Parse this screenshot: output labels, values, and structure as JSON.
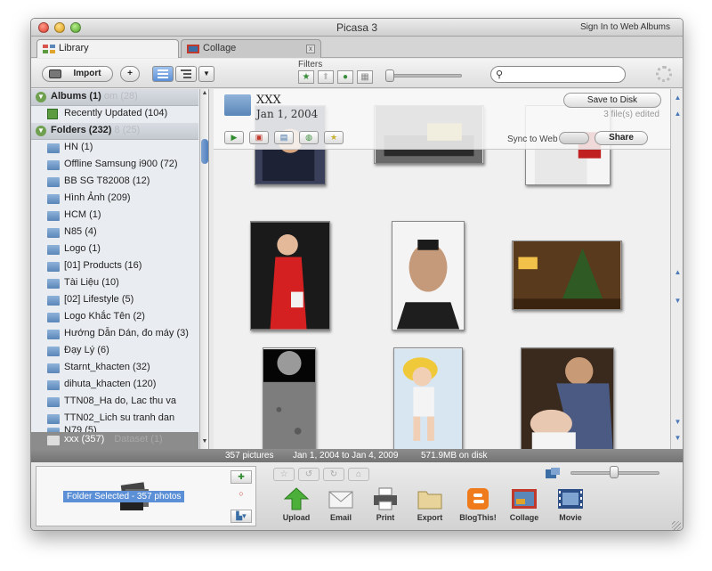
{
  "window": {
    "title": "Picasa 3",
    "sign_in": "Sign In to Web Albums"
  },
  "tabs": [
    {
      "label": "Library"
    },
    {
      "label": "Collage",
      "close": "x"
    }
  ],
  "toolbar": {
    "import_label": "Import",
    "add_folder_label": "+",
    "filters_label": "Filters",
    "search_placeholder": ""
  },
  "sidebar": {
    "albums_header": "Albums (1)",
    "albums_ghost": "om (28)",
    "recently_updated": "Recently Updated (104)",
    "folders_header": "Folders (232)",
    "folders_ghost": "8 (25)",
    "folders": [
      "HN (1)",
      "Offline Samsung i900 (72)",
      "BB SG T82008 (12)",
      "Hình Ảnh (209)",
      "HCM (1)",
      "N85 (4)",
      "Logo (1)",
      "[01] Products (16)",
      "Tài Liệu (10)",
      "[02] Lifestyle (5)",
      "Logo Khắc Tên (2)",
      "Hướng Dẫn Dán, đo máy (3)",
      "Đạy Lý (6)",
      "Starnt_khacten (32)",
      "dihuta_khacten (120)",
      "TTN08_Ha do, Lac thu va",
      "TTN02_Lich su tranh dan",
      "N79 (5)"
    ],
    "selected_folder": "xxx (357)",
    "selected_ghost": "Dataset (1)"
  },
  "album_header": {
    "title": "XXX",
    "date": "Jan 1, 2004",
    "save_to_disk": "Save to Disk",
    "files_edited": "3 file(s) edited",
    "sync_label": "Sync to Web",
    "share_label": "Share"
  },
  "status": {
    "pictures": "357 pictures",
    "date_range": "Jan 1, 2004 to Jan 4, 2009",
    "size": "571.9MB on disk"
  },
  "tray": {
    "label": "Folder Selected - 357 photos"
  },
  "actions": [
    {
      "label": "Upload",
      "icon": "upload-arrow-icon"
    },
    {
      "label": "Email",
      "icon": "envelope-icon"
    },
    {
      "label": "Print",
      "icon": "printer-icon"
    },
    {
      "label": "Export",
      "icon": "folder-export-icon"
    },
    {
      "label": "BlogThis!",
      "icon": "blogger-icon"
    },
    {
      "label": "Collage",
      "icon": "collage-icon"
    },
    {
      "label": "Movie",
      "icon": "film-icon"
    }
  ],
  "colors": {
    "selection_blue": "#5b8fd6",
    "status_bar": "#7d7d7d",
    "folder_blue": "#5a86b8"
  }
}
